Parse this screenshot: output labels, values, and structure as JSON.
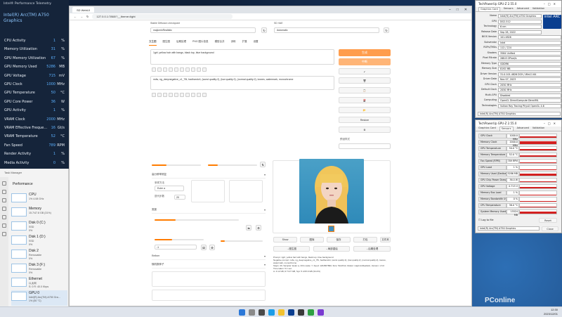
{
  "overlay": {
    "title": "Intel® Performance Telemetry",
    "gpu_name": "Intel(R) Arc(TM) A750 Graphics",
    "rows": [
      {
        "name": "CPU Activity",
        "value": "1",
        "unit": "%"
      },
      {
        "name": "Memory Utilization",
        "value": "31",
        "unit": "%"
      },
      {
        "name": "GPU Memory Utilization",
        "value": "67",
        "unit": "%"
      },
      {
        "name": "GPU Memory Used",
        "value": "5286",
        "unit": "MB"
      },
      {
        "name": "GPU Voltage",
        "value": "715",
        "unit": "mV"
      },
      {
        "name": "GPU Clock",
        "value": "1000",
        "unit": "MHz"
      },
      {
        "name": "GPU Temperature",
        "value": "50",
        "unit": "°C"
      },
      {
        "name": "GPU Core Power",
        "value": "36",
        "unit": "W"
      },
      {
        "name": "GPU Activity",
        "value": "1",
        "unit": "%"
      },
      {
        "name": "VRAM Clock",
        "value": "2000",
        "unit": "MHz"
      },
      {
        "name": "VRAM Effective Freque...",
        "value": "16",
        "unit": "Gt/s"
      },
      {
        "name": "VRAM Temperature",
        "value": "52",
        "unit": "°C"
      },
      {
        "name": "Fan Speed",
        "value": "789",
        "unit": "RPM"
      },
      {
        "name": "Render Activity",
        "value": "1",
        "unit": "%"
      },
      {
        "name": "Media Activity",
        "value": "0",
        "unit": "%"
      }
    ]
  },
  "taskman": {
    "header": "Task Manager",
    "section": "Performance",
    "items": [
      {
        "title": "CPU",
        "sub": "1% 4.08 GHz"
      },
      {
        "title": "Memory",
        "sub": "15.7/47.8 GB (31%)"
      },
      {
        "title": "Disk 0 (C:)",
        "sub": "SSD\n0%"
      },
      {
        "title": "Disk 1 (D:)",
        "sub": "SSD\n0%"
      },
      {
        "title": "Disk 2",
        "sub": "Removable\n0%"
      },
      {
        "title": "Disk 3 (F:)",
        "sub": "Removable\n0%"
      },
      {
        "title": "Ethernet",
        "sub": "以太网\nS: 0 R: 40.0 Kbps"
      },
      {
        "title": "GPU 0",
        "sub": "Intel(R) Arc(TM) A750 Gra...\n1% (50 °C)"
      }
    ]
  },
  "browser": {
    "tab_title": "SD WebUI",
    "url": "127.0.0.1:7860/?__theme=light",
    "model_label": "Stable Diffusion checkpoint",
    "model_value": "majicmixRealistic",
    "vae_label": "SD VAE",
    "vae_value": "Automatic",
    "tabs": [
      "文生图",
      "图生图",
      "后期处理",
      "PNG 图片信息",
      "模型合并",
      "训练",
      "扩展",
      "设置"
    ],
    "prompt_text": "1girl, yellow hair with bangs, black top, blue background",
    "neg_text": "nsfw, ng_deepnegative_v1_75t, badhandv4, (worst quality:2), (low quality:2), (normal quality:2), lowres, watermark, monochrome",
    "generate": "生成",
    "interrupt": "中断",
    "side_buttons": [
      "↙",
      "🗑",
      "📋",
      "🎴",
      "📂",
      "Restore",
      "⚙"
    ],
    "styles_label": "预设样式",
    "sampling_method_label": "采样方法",
    "sampling_method": "Euler a",
    "steps_label": "迭代步数",
    "steps": "20",
    "hires_label": "高分辨率修复",
    "refiner_label": "Refiner",
    "width_label": "宽度",
    "height_label": "高度",
    "cfg_label": "提示词引导系数",
    "seed_label": "随机数种子",
    "seed": "-1",
    "img_actions": [
      "Show",
      "图库",
      "保存",
      "打包",
      "文件夹"
    ],
    "send_to": [
      "→图生图",
      "→局部重绘",
      "→后期处理"
    ],
    "info_text": "Prompt: 1girl, yellow hair with bangs, black top, blue background\nNegative prompt: nsfw, ng_deepnegative_v1_75t, badhandv4, (worst quality:2), (low quality:2), (normal quality:2), lowres, watermark, monochrome\nSteps: 20, Sampler: Euler a, CFG scale: 7, Seed: 1234567890, Size: 512x512, Model: majicmixRealistic, Version: 1.6.0\nTime taken: 5.1 sec.\nA: 4.12 GB, R: 5.07 GB, Sys: 5.4/15.9 GB (34.2%)"
  },
  "gpuz_main": {
    "title": "TechPowerUp GPU-Z 2.55.0",
    "tabs": [
      "Graphics Card",
      "Sensors",
      "Advanced",
      "Validation"
    ],
    "fields": [
      {
        "k": "Name",
        "v": "Intel(R) Arc(TM) A750 Graphics"
      },
      {
        "k": "GPU",
        "v": "DG2-512"
      },
      {
        "k": "Technology",
        "v": "6 nm"
      },
      {
        "k": "Release Date",
        "v": "Sep 28, 2022"
      },
      {
        "k": "BIOS Version",
        "v": "101.4826"
      },
      {
        "k": "Subvendor",
        "v": "Intel"
      },
      {
        "k": "ROPs/TMUs",
        "v": "112 / 224"
      },
      {
        "k": "Shaders",
        "v": "3584 Unified"
      },
      {
        "k": "Pixel Fillrate",
        "v": "268.8 GPixel/s"
      },
      {
        "k": "Memory Type",
        "v": "GDDR6"
      },
      {
        "k": "Memory Size",
        "v": "8192 MB"
      },
      {
        "k": "Driver Version",
        "v": "31.0.101.4826 DCH / Win11 64"
      },
      {
        "k": "Driver Date",
        "v": "Nov 07, 2023"
      },
      {
        "k": "GPU Clock",
        "v": "2050 MHz"
      },
      {
        "k": "Default Clock",
        "v": "2050 MHz"
      },
      {
        "k": "Multi-GPU",
        "v": "Disabled"
      },
      {
        "k": "Computing",
        "v": "OpenCL  DirectCompute  DirectML"
      },
      {
        "k": "Technologies",
        "v": "Vulkan  Ray Tracing  PhysX  OpenGL 4.6"
      }
    ],
    "footer_gpu": "Intel(R) Arc(TM) A750 Graphics",
    "logo": "intel ARC"
  },
  "gpuz_sensors": {
    "title": "TechPowerUp GPU-Z 2.55.0",
    "tabs": [
      "Graphics Card",
      "Sensors",
      "Advanced",
      "Validation"
    ],
    "sensors": [
      {
        "k": "GPU Clock",
        "v": "1000.0 MHz",
        "level": 0.45
      },
      {
        "k": "Memory Clock",
        "v": "2000.0 MHz",
        "level": 0.9
      },
      {
        "k": "GPU Temperature",
        "v": "50.0 °C",
        "level": 0.4
      },
      {
        "k": "Memory Temperature",
        "v": "52.0 °C",
        "level": 0.42
      },
      {
        "k": "Fan Speed (RPM)",
        "v": "789 RPM",
        "level": 0.25
      },
      {
        "k": "GPU Load",
        "v": "1 %",
        "level": 0.05
      },
      {
        "k": "Memory Used (Dedicated)",
        "v": "5286 MB",
        "level": 0.65
      },
      {
        "k": "GPU Chip Power Draw",
        "v": "36.0 W",
        "level": 0.2
      },
      {
        "k": "GPU Voltage",
        "v": "0.715 V",
        "level": 0.35
      },
      {
        "k": "Memory Bus Load",
        "v": "1 %",
        "level": 0.05
      },
      {
        "k": "Memory Bandwidth Usage",
        "v": "0 %",
        "level": 0.02
      },
      {
        "k": "CPU Temperature",
        "v": "36.0 °C",
        "level": 0.3
      },
      {
        "k": "System Memory Used",
        "v": "15524 MB",
        "level": 0.55
      }
    ],
    "log_label": "Log to file",
    "reset": "Reset",
    "footer_gpu": "Intel(R) Arc(TM) A750 Graphics",
    "close": "Close"
  },
  "taskbar": {
    "time": "12:30",
    "date": "2023/12/01"
  },
  "watermark": "PConline"
}
